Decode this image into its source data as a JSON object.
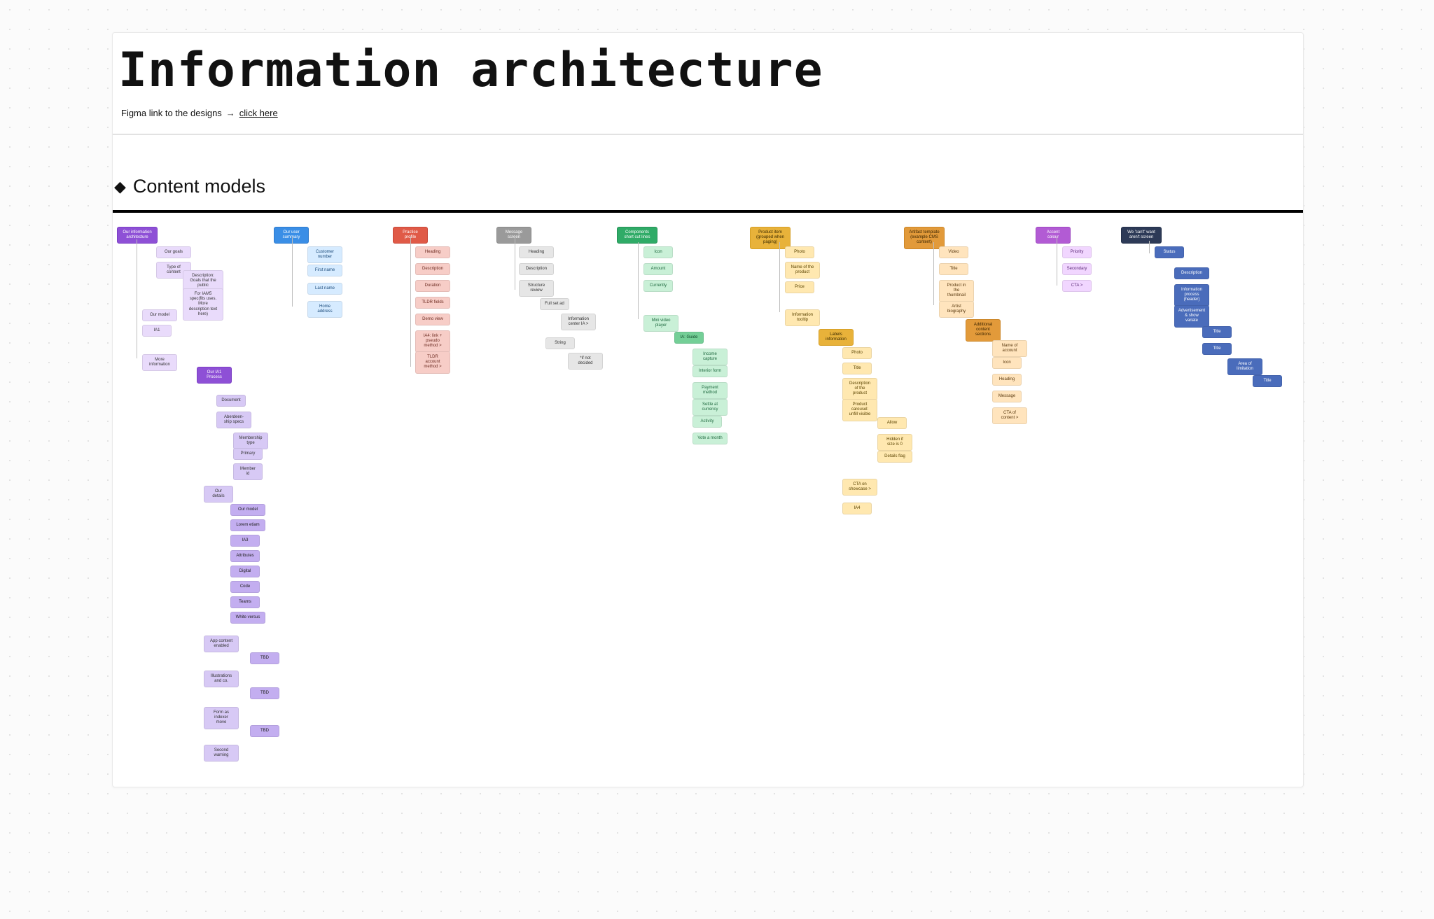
{
  "header": {
    "title": "Information architecture",
    "subtitle_prefix": "Figma link to the designs",
    "arrow": "→",
    "link_label": "click here"
  },
  "section": {
    "icon": "◆",
    "title": "Content models"
  },
  "columns": {
    "c1": {
      "root": "Our information architecture",
      "n1": "Our goals",
      "n2": "Type of content",
      "n2a": "Description: Goals that the public",
      "n2b": "For IAM5 spec(fits uses. More description text here)",
      "n3": "Our model",
      "n4": "IA1",
      "n5": "More information",
      "n5_root": "Our IA1 Process",
      "p1": "Document",
      "p2": "Aberdeen-ship specs",
      "p3": "Membership type",
      "p4": "Primary",
      "p5": "Member id",
      "d_root": "Our details",
      "d1": "Our model",
      "d2": "Lorem etiam",
      "d3": "IA3",
      "d4": "Attributes",
      "d5": "Digital",
      "d6": "Code",
      "d7": "Teams",
      "d8": "White versus",
      "w1": "App content enabled",
      "w1a": "TBD",
      "w2": "Illustrations and co.",
      "w2a": "TBD",
      "w3": "Form as indexer move",
      "w3a": "TBD",
      "w4": "Second warning"
    },
    "c2": {
      "root": "Our user summary",
      "n1": "Customer number",
      "n2": "First name",
      "n3": "Last name",
      "n4": "Home address"
    },
    "c3": {
      "root": "Practice profile",
      "n1": "Heading",
      "n2": "Description",
      "n3": "Duration",
      "n4": "TLDR fields",
      "n5": "Demo view",
      "n6": "IA4: link + pseudo method >",
      "n7": "TLDR account method >"
    },
    "c4": {
      "root": "Message screen",
      "n1": "Heading",
      "n2": "Description",
      "n3": "Structure review",
      "s1": "Full set ad",
      "s2": "Information center IA >",
      "s3": "String",
      "s3a": "*if not decided"
    },
    "c5": {
      "root": "Components short cut lines",
      "n1": "Icon",
      "n2": "Amount",
      "n3": "Currently",
      "g_root": "Mini video player",
      "g_sub": "IA: Guide",
      "g1": "Income capture",
      "g2": "Interior form",
      "g3": "Payment method",
      "g4": "Settle at currency",
      "g5": "Activity",
      "g6": "Vote a month"
    },
    "c6": {
      "root": "Product item (grouped when paging)",
      "n1": "Photo",
      "n2": "Name of the product",
      "n3": "Price",
      "m_label": "Information tooltip",
      "m_root": "Labels information",
      "m1": "Photo",
      "m2": "Title",
      "m3": "Description of the product",
      "m4": "Product carousel: unfill visible",
      "mm1": "Allow",
      "mm2": "Hidden if size is 0",
      "mm3": "Details flag",
      "cta": "CTA on showcase >",
      "cta1": "IA4"
    },
    "c7": {
      "root": "Artifact template (example CMS content)",
      "n1": "Video",
      "n2": "Title",
      "n3": "Product in the thumbnail",
      "n4": "Artist biography",
      "o_root": "Additional content sections",
      "o1": "Name of account",
      "o2": "Icon",
      "o3": "Heading",
      "o4": "Message",
      "o5": "CTA of content >"
    },
    "c8": {
      "root": "Accent colour",
      "n1": "Priority",
      "n2": "Secondary",
      "n3": "CTA >"
    },
    "c9": {
      "root": "We 'can't' want aren't screen",
      "n1": "Status",
      "n2": "Description",
      "n3": "Information process (header)",
      "n4": "Advertisement & show variate",
      "n5": "Title",
      "n6": "Title",
      "n7": "Area of limitation",
      "n8": "Title"
    }
  }
}
